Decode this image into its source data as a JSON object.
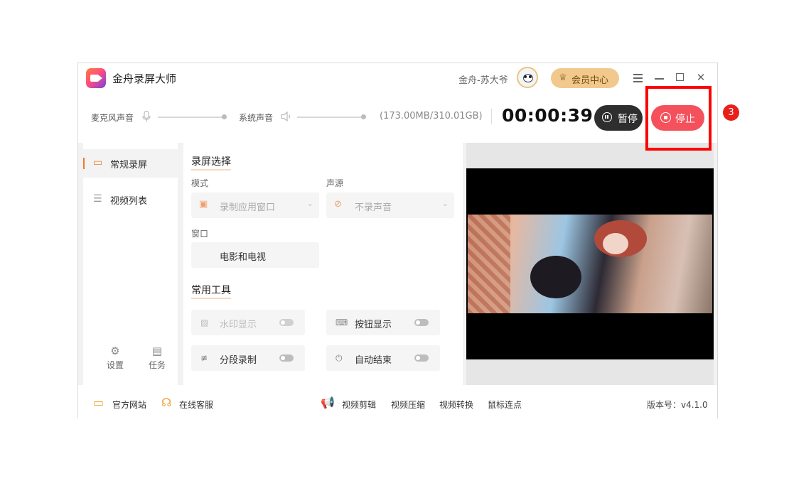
{
  "app": {
    "title": "金舟录屏大师",
    "username": "金舟-苏大爷",
    "vip_label": "会员中心"
  },
  "control_bar": {
    "mic_label": "麦克风声音",
    "system_label": "系统声音",
    "storage": "(173.00MB/310.01GB)",
    "timer": "00:00:39",
    "pause_label": "暂停",
    "stop_label": "停止"
  },
  "sidebar": {
    "items": [
      {
        "label": "常规录屏",
        "active": true
      },
      {
        "label": "视频列表",
        "active": false
      }
    ],
    "bottom": [
      {
        "label": "设置"
      },
      {
        "label": "任务"
      }
    ]
  },
  "panel": {
    "record_title": "录屏选择",
    "mode_label": "模式",
    "mode_value": "录制应用窗口",
    "source_label": "声源",
    "source_value": "不录声音",
    "window_label": "窗口",
    "window_value": "电影和电视",
    "tools_title": "常用工具",
    "tools": [
      {
        "label": "水印显示",
        "enabled": false,
        "on": false
      },
      {
        "label": "按钮显示",
        "enabled": true,
        "on": false
      },
      {
        "label": "分段录制",
        "enabled": true,
        "on": false
      },
      {
        "label": "自动结束",
        "enabled": true,
        "on": false
      }
    ]
  },
  "footer": {
    "official_site": "官方网站",
    "online_service": "在线客服",
    "links": [
      "视频剪辑",
      "视频压缩",
      "视频转换",
      "鼠标连点"
    ],
    "version": "版本号：v4.1.0"
  },
  "annotation": {
    "step_number": "3",
    "highlight_color": "#ff0000"
  },
  "colors": {
    "accent": "#f07a2a",
    "stop": "#f4515c",
    "pause": "#2e2e2e",
    "vip": "#f1c98d"
  }
}
